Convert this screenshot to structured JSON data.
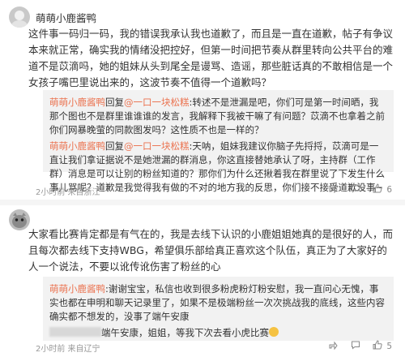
{
  "comments": [
    {
      "username": "萌萌小鹿酱鸭",
      "body": "这件事一码归一码，我的错误我承认我也道歉了，而且是一直在道歉，帖子有争议本来就正常，确实我的情绪没把控好，但第一时间把节奏从群里转向公共平台的难道不是苡滴吗，她的姐妹从头到尾全是谩骂、造谣，那些脏话真的不敢相信是一个女孩子嘴巴里说出来的，这波节奏不值得一个道歉吗？",
      "replies": [
        {
          "author": "萌萌小鹿酱鸭",
          "verb": "回复",
          "target": "@一口一块松糕",
          "text": ":转述不是泄漏是吧，你们可是第一时间晒，我那个图也不是群里谁谁谁的发言，我解释下我被干嘛了有问题？苡滴不也拿着之前你们网暴晚萤的同款图发吗？这性质不也是一样的？"
        },
        {
          "author": "萌萌小鹿酱鸭",
          "verb": "回复",
          "target": "@一口一块松糕",
          "text": ":天呐，姐妹我建议你脑子先捋捋，苡滴可是一直让我们拿证据说不是她泄漏的群消息，你这直接替她承认了呀，主持群（工作群）消息是可以让别的粉丝知道的？那你们为什么还揪着我在群里说了下发生什么事儿骂呢？道歉是我觉得我有做的不对的地方我的反思，你们接不接受道歉没事~"
        }
      ],
      "meta": "2小时前 来自浙江",
      "likes": "6"
    },
    {
      "username": "",
      "body": "大家看比赛肯定都是有气在的，我是去线下认识的小鹿姐姐她真的是很好的人，而且每次都去线下支持WBG，希望俱乐部给真正喜欢这个队伍，真正为了大家好的人一个说法，不要以讹传讹伤害了粉丝的心",
      "replies": [
        {
          "author": "萌萌小鹿酱鸭",
          "verb": "",
          "target": "",
          "text": ":谢谢宝宝，私信也收到很多粉虎粉灯粉安慰，我一直问心无愧，事实也都在申明和聊天记录里了，如果不是极端粉丝一次次挑战我的底线，这些内容确实都不想发的，没事了端午安康"
        },
        {
          "author": "",
          "verb": "",
          "target": "",
          "text": "端午安康，姐姐，等我下次去看小虎比赛"
        }
      ],
      "meta": "2小时前 来自辽宁",
      "likes": "5"
    }
  ],
  "colors": {
    "accent": "#eb7350",
    "text": "#333333",
    "meta": "#999999",
    "reply_bg": "#f2f2f2"
  },
  "icons": {
    "share": "share-icon",
    "comment": "comment-icon",
    "like": "like-icon"
  }
}
